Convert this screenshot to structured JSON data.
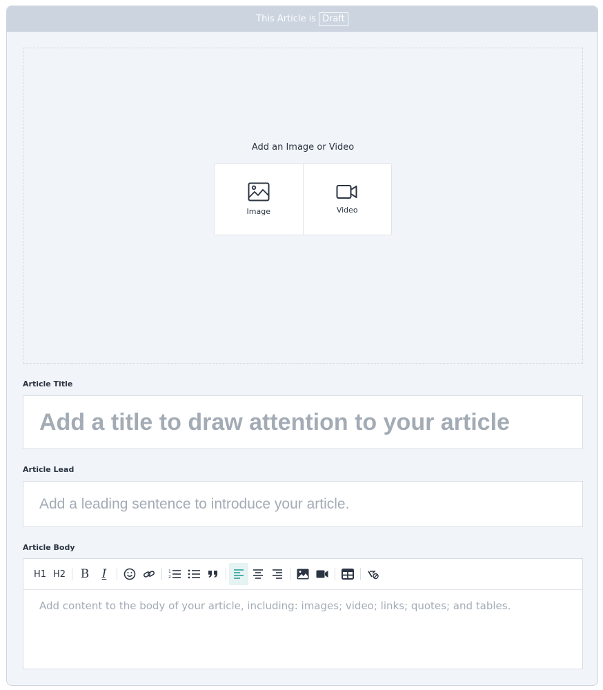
{
  "status": {
    "prefix": "This Article is",
    "badge": "Draft"
  },
  "media": {
    "heading": "Add an Image or Video",
    "buttons": [
      {
        "label": "Image",
        "icon": "image-icon"
      },
      {
        "label": "Video",
        "icon": "video-camera-icon"
      }
    ]
  },
  "title_field": {
    "label": "Article Title",
    "placeholder": "Add a title to draw attention to your article",
    "value": ""
  },
  "lead_field": {
    "label": "Article Lead",
    "placeholder": "Add a leading sentence to introduce your article.",
    "value": ""
  },
  "body_field": {
    "label": "Article Body",
    "placeholder": "Add content to the body of your article, including: images; video; links; quotes; and tables.",
    "value": "",
    "toolbar": {
      "h1": "H1",
      "h2": "H2",
      "bold": "B",
      "italic": "I",
      "icons": [
        "emoji-icon",
        "link-icon",
        "ordered-list-icon",
        "bullet-list-icon",
        "quote-icon",
        "align-left-icon",
        "align-center-icon",
        "align-right-icon",
        "insert-image-icon",
        "insert-video-icon",
        "insert-table-icon",
        "clear-format-icon"
      ],
      "active": "align-left"
    }
  },
  "colors": {
    "accent": "#2aa198",
    "status_bar": "#cbd4df",
    "background": "#f1f4f8",
    "placeholder": "#a3abb5"
  }
}
